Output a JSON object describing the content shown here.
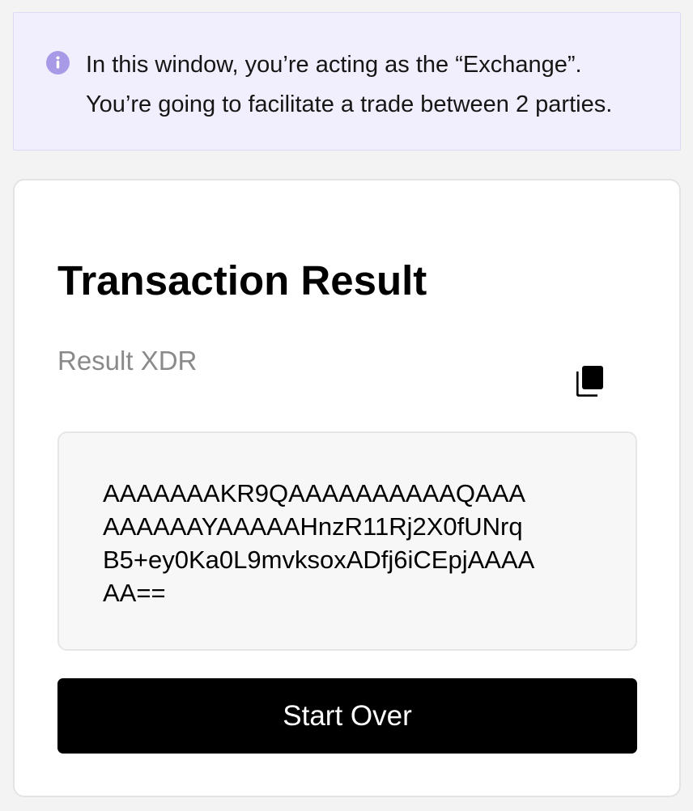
{
  "banner": {
    "icon": "info-icon",
    "line1": "In this window, you’re acting as the “Exchange”.",
    "line2": "You’re going to facilitate a trade between 2 parties."
  },
  "card": {
    "title": "Transaction Result",
    "result_label": "Result XDR",
    "copy_icon": "copy-icon",
    "xdr_value": "AAAAAAAKR9QAAAAAAAAAAQAAA\nAAAAAAYAAAAAHnzR11Rj2X0fUNrq\nB5+ey0Ka0L9mvksoxADfj6iCEpjAAAA\nAA==",
    "start_over_label": "Start Over"
  },
  "colors": {
    "page_bg": "#f3f3f3",
    "banner_bg": "#f1effd",
    "info_icon": "#a99ae8",
    "button_bg": "#000000"
  }
}
